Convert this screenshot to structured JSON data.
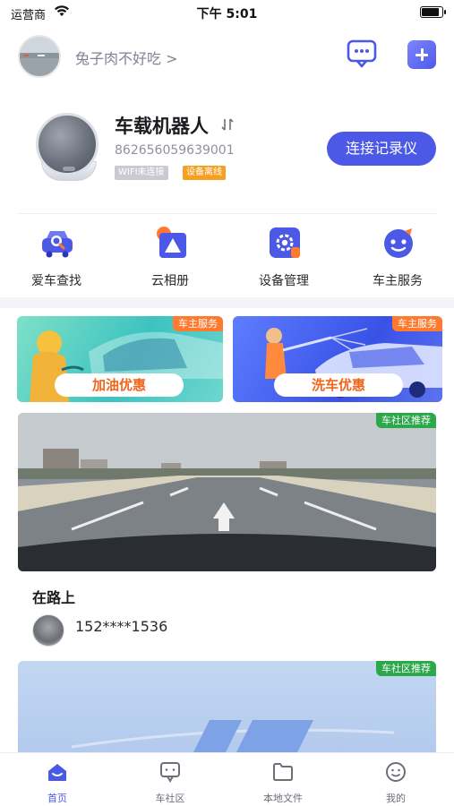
{
  "status_bar": {
    "carrier": "运营商",
    "time": "下午 5:01"
  },
  "header": {
    "user_name": "兔子肉不好吃 >"
  },
  "device": {
    "name": "车载机器人",
    "id": "862656059639001",
    "wifi_status": "WIFI未连接",
    "online_status": "设备离线",
    "connect_label": "连接记录仪"
  },
  "quick_menu": [
    {
      "label": "爱车查找",
      "icon": "car-search-icon"
    },
    {
      "label": "云相册",
      "icon": "cloud-album-icon"
    },
    {
      "label": "设备管理",
      "icon": "device-settings-icon"
    },
    {
      "label": "车主服务",
      "icon": "owner-service-icon"
    }
  ],
  "promos": [
    {
      "tag": "车主服务",
      "label": "加油优惠"
    },
    {
      "tag": "车主服务",
      "label": "洗车优惠"
    }
  ],
  "feed": [
    {
      "tag": "车社区推荐",
      "title": "在路上",
      "author": "152****1536"
    },
    {
      "tag": "车社区推荐"
    }
  ],
  "tabs": [
    {
      "label": "首页",
      "active": true
    },
    {
      "label": "车社区"
    },
    {
      "label": "本地文件"
    },
    {
      "label": "我的"
    }
  ],
  "colors": {
    "accent": "#4c58e6",
    "warning": "#f5a023",
    "promo_tag": "#ff7a2f",
    "community_tag": "#2ba84a"
  }
}
